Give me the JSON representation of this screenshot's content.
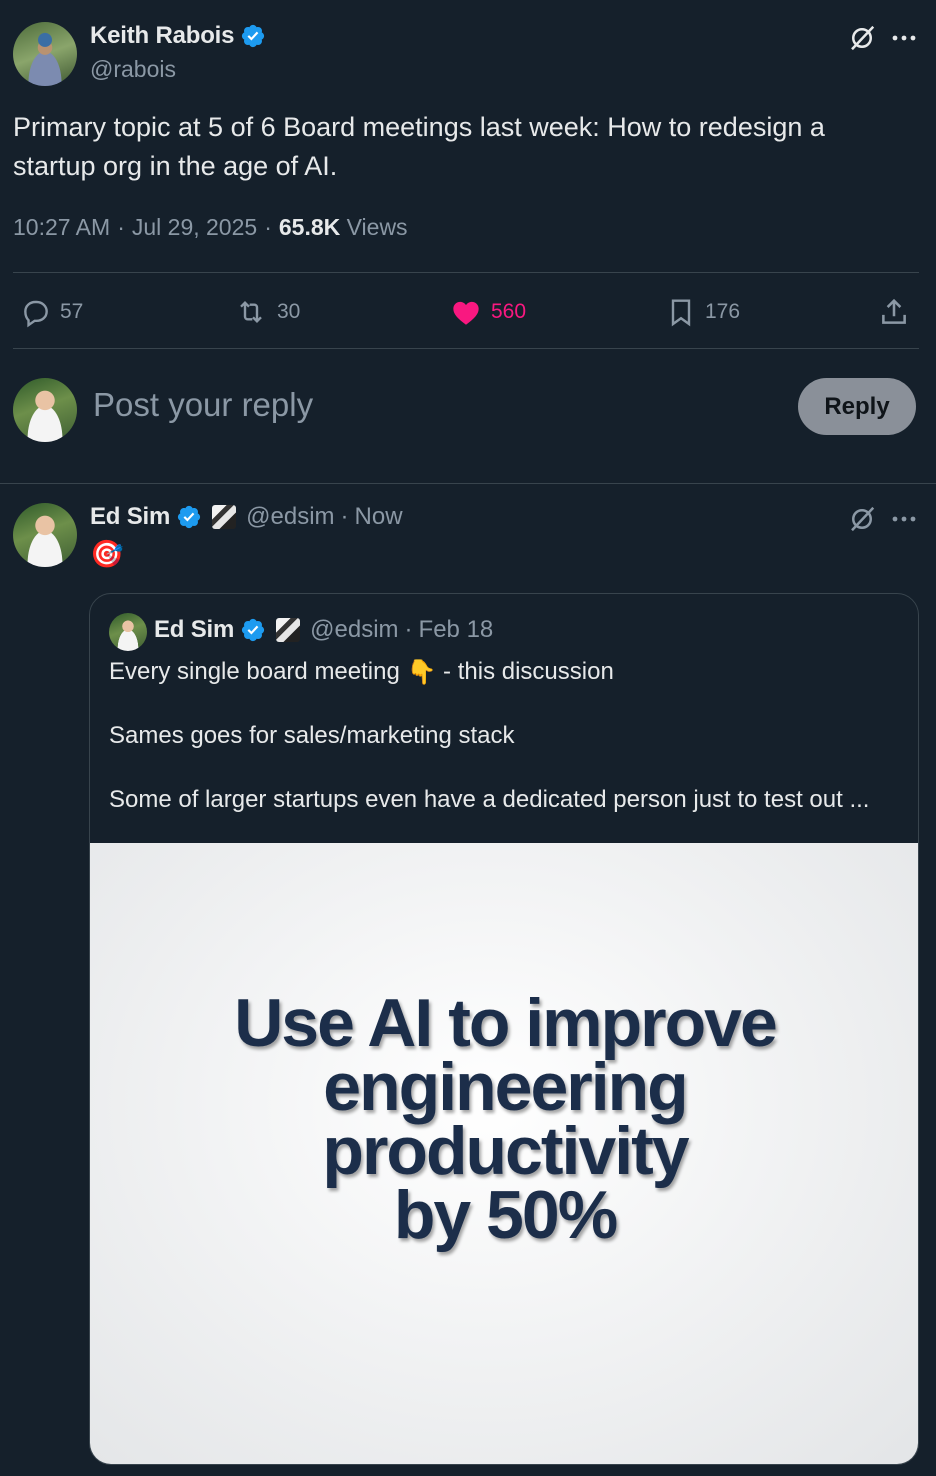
{
  "main_tweet": {
    "author_name": "Keith Rabois",
    "author_handle": "@rabois",
    "text_line1": "Primary topic at 5 of 6 Board meetings last week:  How to redesign a",
    "text_line2": "startup org in the age of AI.",
    "time": "10:27 AM",
    "sep1": "·",
    "date": "Jul 29, 2025",
    "sep2": "·",
    "views_count": "65.8K",
    "views_label": "Views",
    "replies": "57",
    "reposts": "30",
    "likes": "560",
    "bookmarks": "176"
  },
  "compose": {
    "placeholder": "Post your reply",
    "button_label": "Reply"
  },
  "reply_tweet": {
    "author_name": "Ed Sim",
    "author_handle": "@edsim",
    "sep": "·",
    "time": "Now",
    "emoji": "🎯"
  },
  "quoted_tweet": {
    "author_name": "Ed Sim",
    "author_handle": "@edsim",
    "sep": "·",
    "date": "Feb 18",
    "line1_a": "Every single board meeting",
    "line1_emoji": "👇",
    "line1_b": " - this discussion",
    "line2": "Sames goes for sales/marketing stack",
    "line3": "Some of larger startups even have a dedicated person just to test out ...",
    "image_text": [
      "Use AI to improve",
      "engineering",
      "productivity",
      "by 50%"
    ]
  },
  "colors": {
    "background": "#15202b",
    "text": "#e7e9ea",
    "muted": "#8b98a5",
    "like_active": "#f91880",
    "verified": "#1d9bf0",
    "divider": "#38444d"
  },
  "icons": [
    "grok-icon",
    "more-icon",
    "reply-icon",
    "repost-icon",
    "like-icon",
    "bookmark-icon",
    "share-icon",
    "verified-badge-icon"
  ]
}
